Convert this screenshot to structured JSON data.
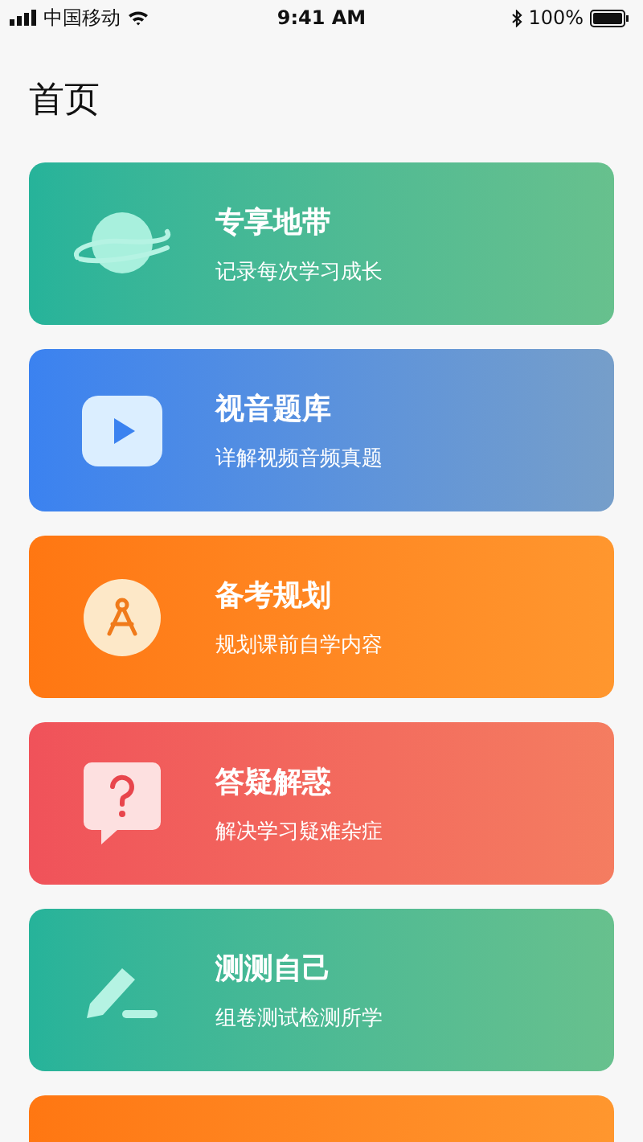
{
  "status_bar": {
    "carrier": "中国移动",
    "time": "9:41 AM",
    "battery": "100%"
  },
  "page_title": "首页",
  "cards": [
    {
      "kind": "planet",
      "title": "专享地带",
      "subtitle": "记录每次学习成长",
      "color": "#26b39a"
    },
    {
      "kind": "video",
      "title": "视音题库",
      "subtitle": "详解视频音频真题",
      "color": "#3b82f0"
    },
    {
      "kind": "compass",
      "title": "备考规划",
      "subtitle": "规划课前自学内容",
      "color": "#ff7712"
    },
    {
      "kind": "question",
      "title": "答疑解惑",
      "subtitle": "解决学习疑难杂症",
      "color": "#f0525a"
    },
    {
      "kind": "pen",
      "title": "测测自己",
      "subtitle": "组卷测试检测所学",
      "color": "#26b39a"
    },
    {
      "kind": "blank",
      "color": "#ff7712"
    }
  ]
}
